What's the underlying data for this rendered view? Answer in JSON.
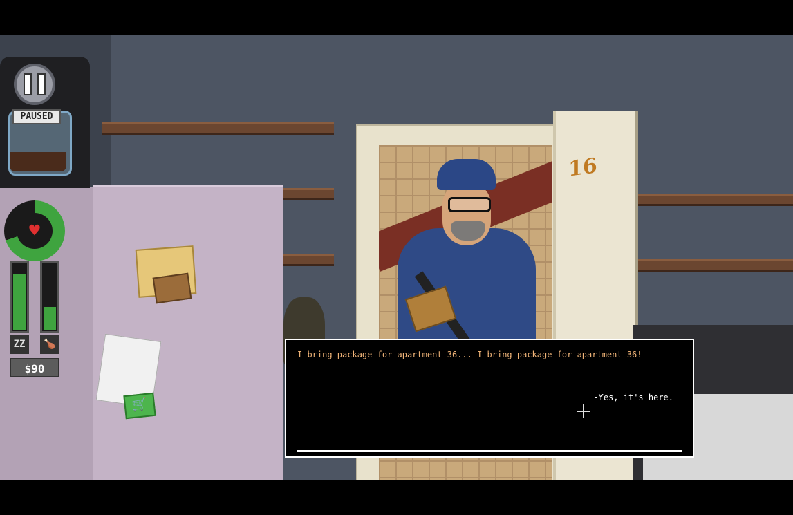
{
  "hud": {
    "paused_label": "PAUSED",
    "money": "$90",
    "health_fraction": 0.7,
    "sleep_fraction": 0.85,
    "hunger_fraction": 0.35,
    "sleep_icon": "zzz-icon",
    "hunger_icon": "drumstick-icon",
    "heart_icon": "heart-icon",
    "heart_glyph": "♥",
    "sleep_glyph": "ZZ",
    "hunger_glyph": "🍗",
    "cart_glyph": "🛒"
  },
  "scene": {
    "door_number": "16"
  },
  "dialog": {
    "line": "I bring package for apartment 36... I bring package for apartment 36!",
    "option": "-Yes, it's here."
  },
  "colors": {
    "dialog_text": "#f0b478",
    "health_green": "#3fa43f",
    "heart_red": "#e03030"
  }
}
